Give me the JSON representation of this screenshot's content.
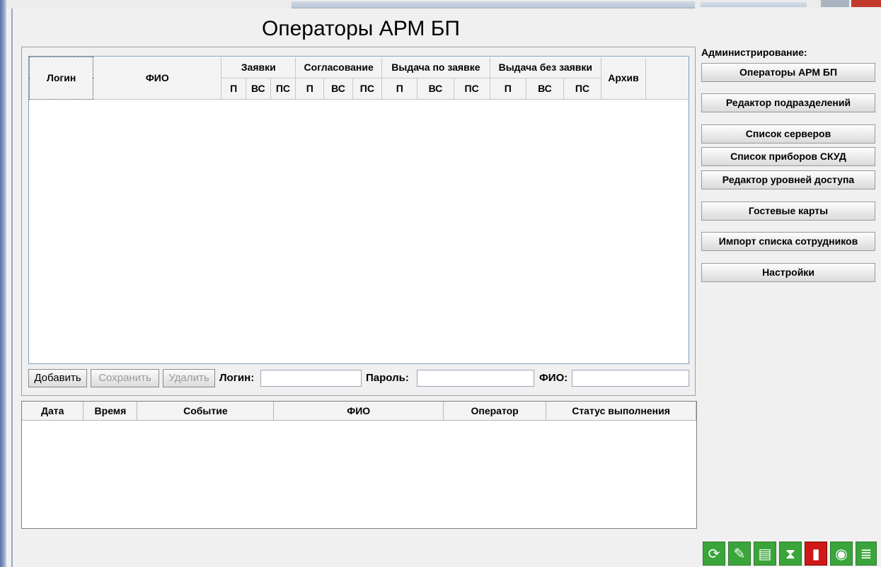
{
  "window": {
    "title": "Операторы АРМ БП"
  },
  "operators_table": {
    "col_login": "Логин",
    "col_fio": "ФИО",
    "group_requests": "Заявки",
    "group_approval": "Согласование",
    "group_issue_by_request": "Выдача по заявке",
    "group_issue_without_request": "Выдача без заявки",
    "col_archive": "Архив",
    "sub_p": "П",
    "sub_vs": "ВС",
    "sub_ps": "ПС"
  },
  "form": {
    "add_label": "Добавить",
    "save_label": "Сохранить",
    "delete_label": "Удалить",
    "login_label": "Логин:",
    "password_label": "Пароль:",
    "fio_label": "ФИО:",
    "login_value": "",
    "password_value": "",
    "fio_value": ""
  },
  "events_table": {
    "columns": [
      "Дата",
      "Время",
      "Событие",
      "ФИО",
      "Оператор",
      "Статус выполнения"
    ]
  },
  "admin": {
    "title": "Администрирование:",
    "buttons": [
      "Операторы АРМ БП",
      "Редактор подразделений",
      "Список серверов",
      "Список приборов СКУД",
      "Редактор уровней доступа",
      "Гостевые карты",
      "Импорт списка сотрудников",
      "Настройки"
    ]
  },
  "tray": {
    "icons": [
      "refresh-icon",
      "edit-icon",
      "id-card-icon",
      "hourglass-icon",
      "door-icon",
      "webcam-icon",
      "database-icon"
    ],
    "colors": {
      "green": "#3aa53a",
      "red": "#d01818",
      "blue": "#2f77c9"
    }
  }
}
